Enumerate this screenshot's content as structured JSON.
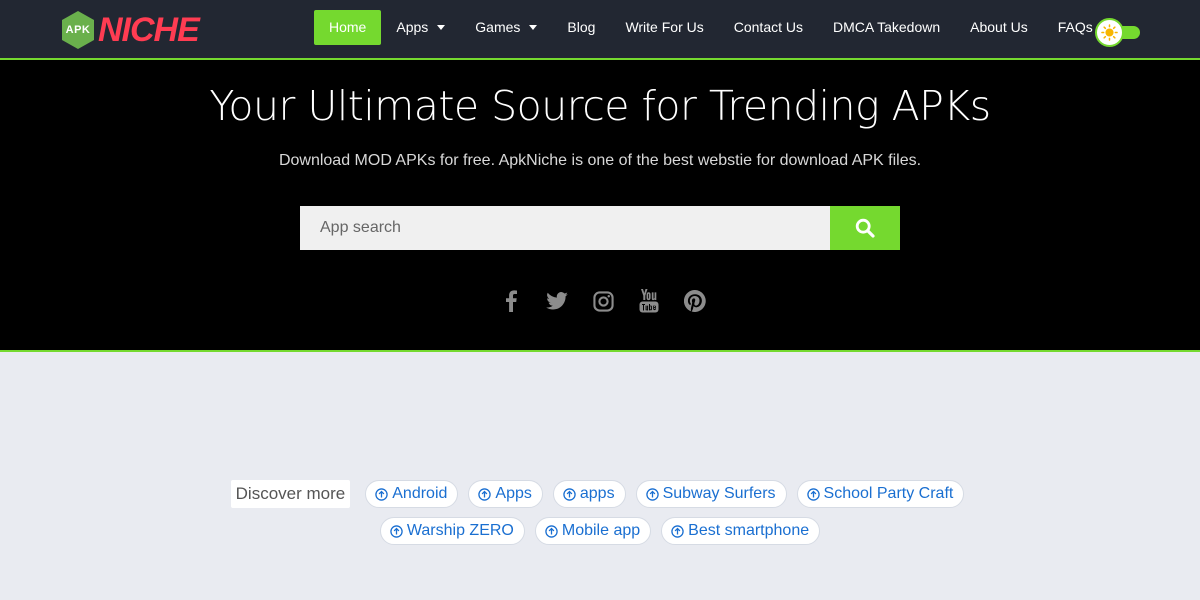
{
  "brand": {
    "badge_text": "APK",
    "name": "NICHE",
    "hex_color": "#6ab04c",
    "name_color": "#ff3c52"
  },
  "nav": {
    "items": [
      {
        "label": "Home",
        "active": true,
        "dropdown": false
      },
      {
        "label": "Apps",
        "active": false,
        "dropdown": true
      },
      {
        "label": "Games",
        "active": false,
        "dropdown": true
      },
      {
        "label": "Blog",
        "active": false,
        "dropdown": false
      },
      {
        "label": "Write For Us",
        "active": false,
        "dropdown": false
      },
      {
        "label": "Contact Us",
        "active": false,
        "dropdown": false
      },
      {
        "label": "DMCA Takedown",
        "active": false,
        "dropdown": false
      },
      {
        "label": "About Us",
        "active": false,
        "dropdown": false
      },
      {
        "label": "FAQs",
        "active": false,
        "dropdown": false
      }
    ],
    "theme_toggle_icon": "sun-icon"
  },
  "hero": {
    "title": "Your Ultimate Source for Trending APKs",
    "subtitle": "Download MOD APKs for free. ApkNiche is one of the best webstie for download APK files."
  },
  "search": {
    "placeholder": "App search",
    "value": "",
    "button_icon": "search-icon"
  },
  "socials": [
    {
      "icon": "facebook-icon"
    },
    {
      "icon": "twitter-icon"
    },
    {
      "icon": "instagram-icon"
    },
    {
      "icon": "youtube-icon"
    },
    {
      "icon": "pinterest-icon"
    }
  ],
  "discover": {
    "label": "Discover more",
    "row1": [
      "Android",
      "Apps",
      "apps",
      "Subway Surfers",
      "School Party Craft"
    ],
    "row2": [
      "Warship ZERO",
      "Mobile app",
      "Best smartphone"
    ]
  },
  "colors": {
    "accent": "#75d92f",
    "header_bg": "#222732",
    "hero_bg": "#000000",
    "page_bg": "#e9ebf1",
    "chip_text": "#1a6fd1"
  }
}
